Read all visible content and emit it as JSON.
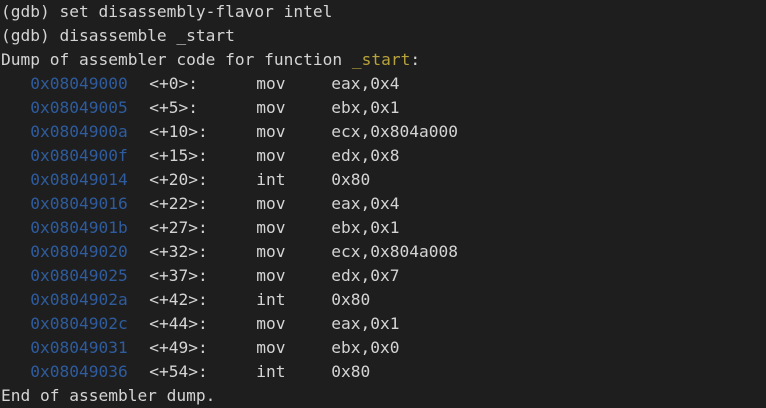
{
  "terminal": {
    "commands": [
      "(gdb) set disassembly-flavor intel",
      "(gdb) disassemble _start"
    ],
    "dump_header": {
      "prefix": "Dump of assembler code for function ",
      "function": "_start",
      "suffix": ":"
    },
    "instructions": [
      {
        "addr": "0x08049000",
        "offset": "<+0>:",
        "mnemonic": "mov",
        "operands": "eax,0x4"
      },
      {
        "addr": "0x08049005",
        "offset": "<+5>:",
        "mnemonic": "mov",
        "operands": "ebx,0x1"
      },
      {
        "addr": "0x0804900a",
        "offset": "<+10>:",
        "mnemonic": "mov",
        "operands": "ecx,0x804a000"
      },
      {
        "addr": "0x0804900f",
        "offset": "<+15>:",
        "mnemonic": "mov",
        "operands": "edx,0x8"
      },
      {
        "addr": "0x08049014",
        "offset": "<+20>:",
        "mnemonic": "int",
        "operands": "0x80"
      },
      {
        "addr": "0x08049016",
        "offset": "<+22>:",
        "mnemonic": "mov",
        "operands": "eax,0x4"
      },
      {
        "addr": "0x0804901b",
        "offset": "<+27>:",
        "mnemonic": "mov",
        "operands": "ebx,0x1"
      },
      {
        "addr": "0x08049020",
        "offset": "<+32>:",
        "mnemonic": "mov",
        "operands": "ecx,0x804a008"
      },
      {
        "addr": "0x08049025",
        "offset": "<+37>:",
        "mnemonic": "mov",
        "operands": "edx,0x7"
      },
      {
        "addr": "0x0804902a",
        "offset": "<+42>:",
        "mnemonic": "int",
        "operands": "0x80"
      },
      {
        "addr": "0x0804902c",
        "offset": "<+44>:",
        "mnemonic": "mov",
        "operands": "eax,0x1"
      },
      {
        "addr": "0x08049031",
        "offset": "<+49>:",
        "mnemonic": "mov",
        "operands": "ebx,0x0"
      },
      {
        "addr": "0x08049036",
        "offset": "<+54>:",
        "mnemonic": "int",
        "operands": "0x80"
      }
    ],
    "footer": "End of assembler dump."
  },
  "colors": {
    "background": "#1e1e1e",
    "text": "#d4d4d4",
    "address": "#2e5c9e",
    "function_name": "#b7a23b"
  }
}
